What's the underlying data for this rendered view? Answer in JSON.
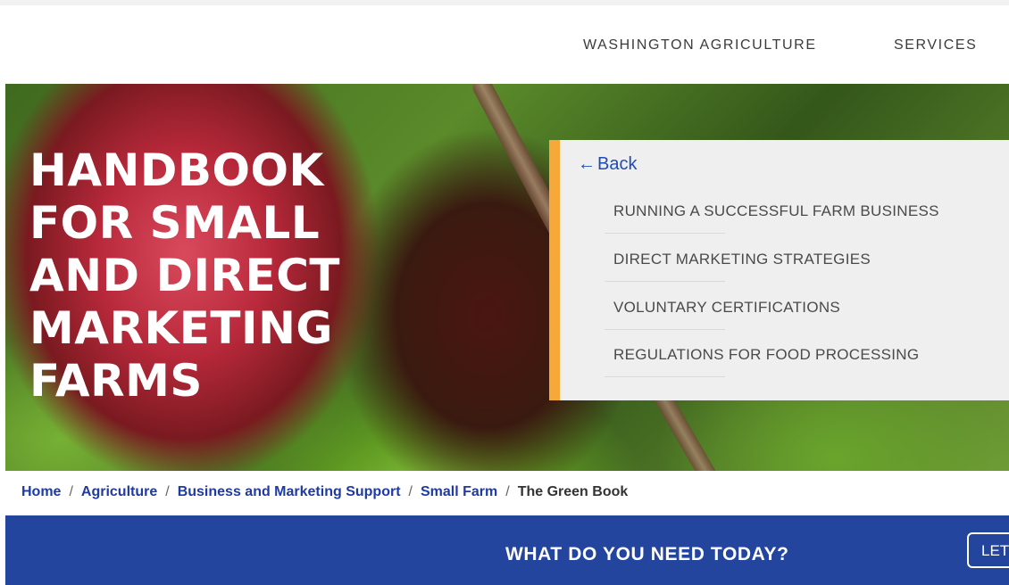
{
  "header": {
    "nav": [
      {
        "label": "WASHINGTON AGRICULTURE"
      },
      {
        "label": "SERVICES"
      }
    ]
  },
  "hero": {
    "title": "HANDBOOK FOR SMALL AND DIRECT MARKETING FARMS"
  },
  "submenu": {
    "back_label": "Back",
    "items": [
      {
        "label": "RUNNING A SUCCESSFUL FARM BUSINESS"
      },
      {
        "label": "DIRECT MARKETING STRATEGIES"
      },
      {
        "label": "VOLUNTARY CERTIFICATIONS"
      },
      {
        "label": "REGULATIONS FOR FOOD PROCESSING"
      }
    ],
    "accent_color": "#f6a839"
  },
  "breadcrumb": {
    "items": [
      {
        "label": "Home"
      },
      {
        "label": "Agriculture"
      },
      {
        "label": "Business and Marketing Support"
      },
      {
        "label": "Small Farm"
      },
      {
        "label": "The Green Book"
      }
    ],
    "separator": "/"
  },
  "cta": {
    "text": "WHAT DO YOU NEED TODAY?",
    "button_label": "LET",
    "background_color": "#23459e"
  },
  "icons": {
    "back": "arrow-left-icon"
  }
}
